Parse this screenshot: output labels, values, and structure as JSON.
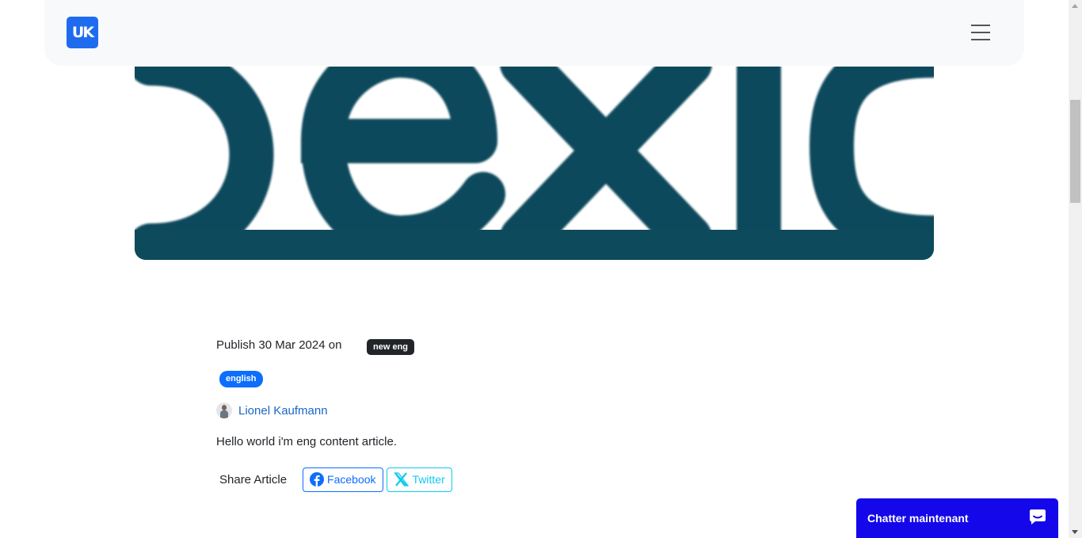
{
  "header": {
    "logo_text": "UK",
    "menu_icon": "hamburger-menu-icon"
  },
  "hero": {
    "image_text": "exio",
    "color": "#0d4a5c"
  },
  "article": {
    "publish_text": "Publish 30 Mar 2024 on",
    "category_tag": "new eng",
    "language_tag": "english",
    "author_name": "Lionel Kaufmann",
    "content": "Hello world i'm eng content article.",
    "share_label": "Share Article",
    "share_buttons": [
      {
        "label": "Facebook",
        "icon": "facebook-icon",
        "color": "#0d6efd"
      },
      {
        "label": "Twitter",
        "icon": "x-twitter-icon",
        "color": "#0dcaf0"
      }
    ]
  },
  "chat": {
    "label": "Chatter maintenant",
    "icon": "chat-bubble-icon",
    "color": "#1408ea"
  }
}
